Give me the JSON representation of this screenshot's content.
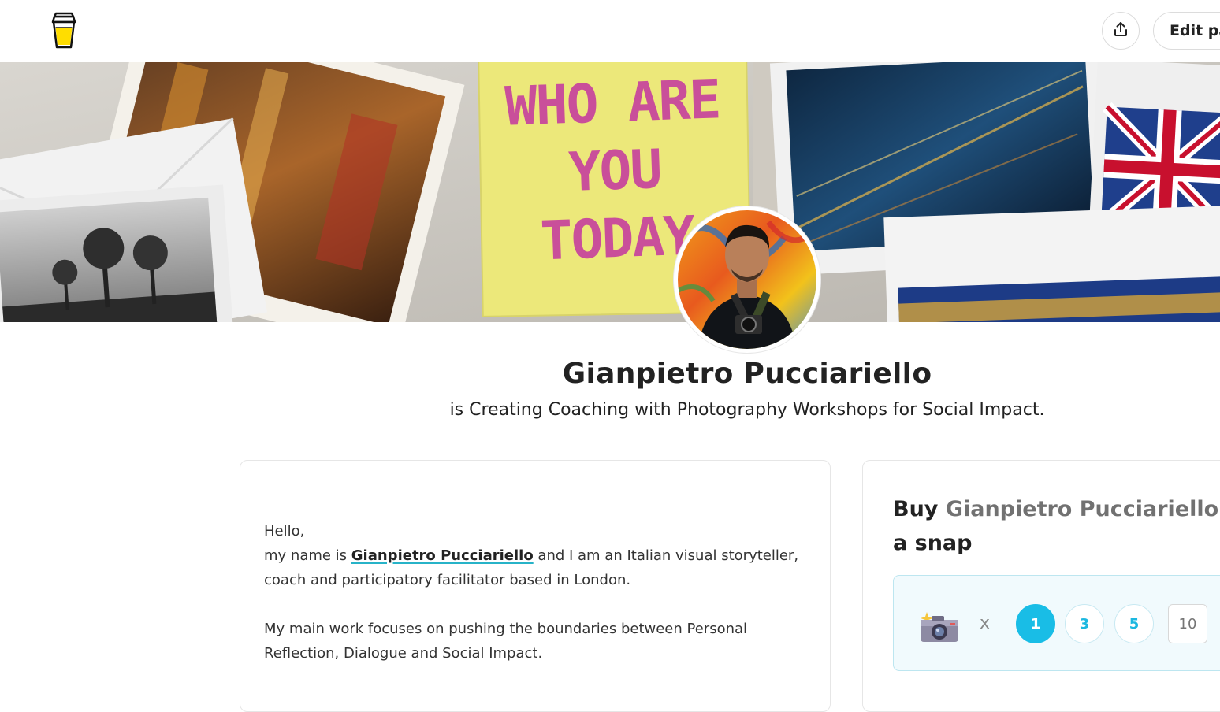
{
  "header": {
    "logo_icon": "coffee-cup-icon",
    "share_icon": "share-upload-icon",
    "edit_button_label": "Edit pa"
  },
  "cover": {
    "note_lines": [
      "WHO ARE",
      "YOU",
      "TODAY"
    ]
  },
  "profile": {
    "name": "Gianpietro Pucciariello",
    "tagline": "is Creating Coaching with Photography Workshops for Social Impact."
  },
  "about": {
    "greeting": "Hello,",
    "intro_before": "my name is ",
    "intro_name": "Gianpietro Pucciariello",
    "intro_after": " and I am an Italian visual storyteller, coach and participatory facilitator based in London.",
    "paragraph2": "My main work focuses on pushing the boundaries between Personal Reflection, Dialogue and Social Impact."
  },
  "support": {
    "title_prefix": "Buy ",
    "title_name": "Gianpietro Pucciariello",
    "title_suffix": " a snap",
    "item_icon": "camera-sparkle-icon",
    "multiplier": "x",
    "quantities": [
      "1",
      "3",
      "5"
    ],
    "selected_quantity": "1",
    "custom_quantity_placeholder": "10"
  },
  "colors": {
    "accent_cyan": "#19bde6",
    "note_yellow": "#ece87a",
    "note_ink": "#c94f9a"
  }
}
